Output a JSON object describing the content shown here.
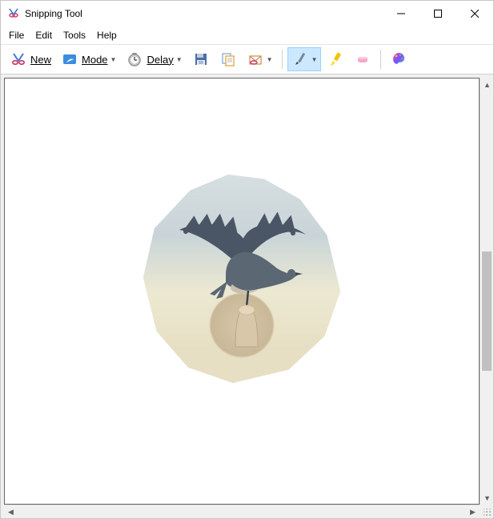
{
  "title": "Snipping Tool",
  "menubar": {
    "file": "File",
    "edit": "Edit",
    "tools": "Tools",
    "help": "Help"
  },
  "toolbar": {
    "new_label": "New",
    "mode_label": "Mode",
    "delay_label": "Delay",
    "icons": {
      "new": "scissors-icon",
      "mode": "rectangle-icon",
      "delay": "clock-icon",
      "save": "floppy-icon",
      "copy": "copy-icon",
      "send": "envelope-icon",
      "pen": "pen-icon",
      "highlighter": "highlighter-icon",
      "eraser": "eraser-icon",
      "paint3d": "paint3d-icon"
    }
  },
  "canvas": {
    "content_description": "Free-form snip of a pigeon taking off from a fingertip against a cloudy beige sky"
  }
}
